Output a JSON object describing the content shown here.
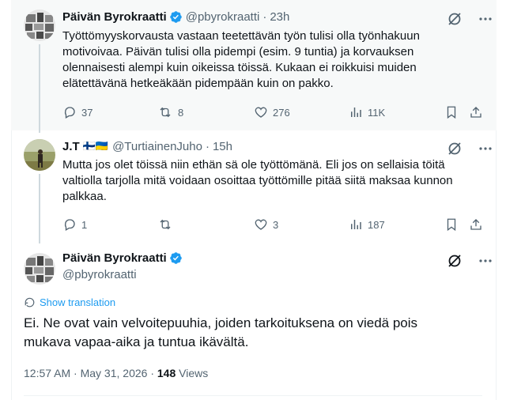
{
  "tweets": [
    {
      "author_name": "Päivän Byrokraatti",
      "handle": "@pbyrokraatti",
      "separator": "·",
      "time": "23h",
      "text": "Työttömyyskorvausta vastaan teetettävän työn tulisi olla työnhakuun motivoivaa. Päivän tulisi olla pidempi (esim. 9 tuntia) ja korvauksen olennaisesti alempi kuin oikeissa töissä. Kukaan ei roikkuisi muiden elätettävänä hetkeäkään pidempään kuin on pakko.",
      "replies": "37",
      "reposts": "8",
      "likes": "276",
      "views": "11K"
    },
    {
      "author_name": "J.T",
      "flags": "🇫🇮🇺🇦",
      "handle": "@TurtiainenJuho",
      "separator": "·",
      "time": "15h",
      "text": "Mutta jos olet töissä niin ethän sä ole työttömänä. Eli jos on sellaisia töitä valtiolla tarjolla mitä voidaan osoittaa työttömille pitää siitä maksaa kunnon palkkaa.",
      "replies": "1",
      "reposts": "",
      "likes": "3",
      "views": "187"
    }
  ],
  "main_tweet": {
    "author_name": "Päivän Byrokraatti",
    "handle": "@pbyrokraatti",
    "show_translation": "Show translation",
    "text": "Ei. Ne ovat vain velvoitepuuhia, joiden tarkoituksena on viedä pois mukava vapaa-aika ja tuntua ikävältä.",
    "timestamp": "12:57 AM · May 31, 2026 ·",
    "views_count": "148",
    "views_label": "Views"
  },
  "colors": {
    "verified": "#1d9bf0",
    "link": "#1d9bf0",
    "muted": "#536471",
    "text": "#0f1419"
  },
  "icons": [
    "verified-badge-icon",
    "grok-icon",
    "more-icon",
    "reply-icon",
    "repost-icon",
    "like-icon",
    "views-icon",
    "bookmark-icon",
    "share-icon",
    "translate-icon"
  ]
}
